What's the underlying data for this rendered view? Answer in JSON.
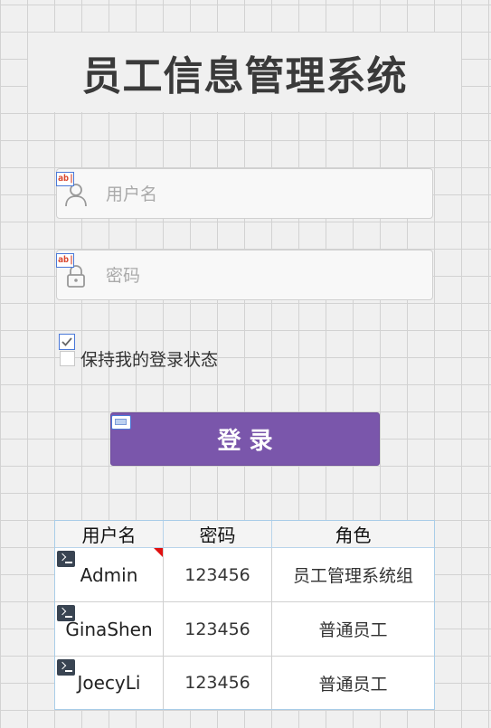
{
  "app": {
    "title": "员工信息管理系统"
  },
  "login_form": {
    "username_placeholder": "用户名",
    "username_value": "",
    "password_placeholder": "密码",
    "password_value": "",
    "remember_label": "保持我的登录状态",
    "remember_checked": false,
    "login_button_label": "登 录",
    "textbox_marker": "ab|",
    "button_color": "#7a56ab"
  },
  "user_table": {
    "columns": [
      "用户名",
      "密码",
      "角色"
    ],
    "rows": [
      {
        "username": "Admin",
        "password": "123456",
        "role": "员工管理系统组"
      },
      {
        "username": "GinaShen",
        "password": "123456",
        "role": "普通员工"
      },
      {
        "username": "JoecyLi",
        "password": "123456",
        "role": "普通员工"
      }
    ]
  },
  "icons": {
    "username_icon": "user-icon",
    "password_icon": "lock-icon",
    "checkbox_marker_icon": "checkbox-designer-icon",
    "button_marker_icon": "button-designer-icon",
    "row_marker_icon": "terminal-icon"
  }
}
